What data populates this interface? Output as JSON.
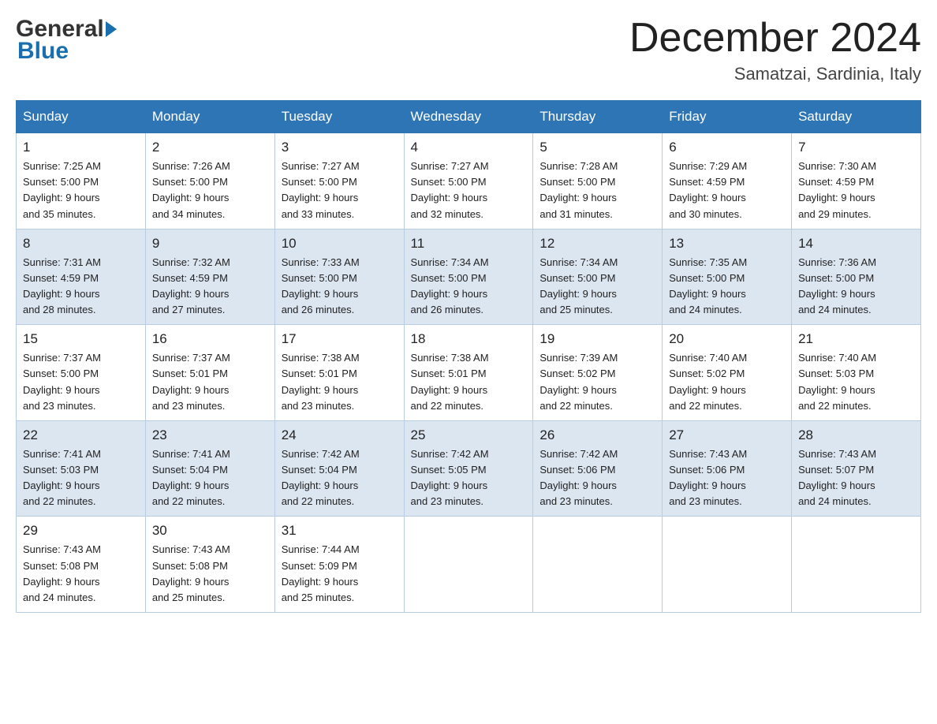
{
  "header": {
    "logo_general": "General",
    "logo_blue": "Blue",
    "month_title": "December 2024",
    "location": "Samatzai, Sardinia, Italy"
  },
  "days_of_week": [
    "Sunday",
    "Monday",
    "Tuesday",
    "Wednesday",
    "Thursday",
    "Friday",
    "Saturday"
  ],
  "weeks": [
    {
      "days": [
        {
          "num": "1",
          "sunrise": "7:25 AM",
          "sunset": "5:00 PM",
          "daylight": "9 hours and 35 minutes."
        },
        {
          "num": "2",
          "sunrise": "7:26 AM",
          "sunset": "5:00 PM",
          "daylight": "9 hours and 34 minutes."
        },
        {
          "num": "3",
          "sunrise": "7:27 AM",
          "sunset": "5:00 PM",
          "daylight": "9 hours and 33 minutes."
        },
        {
          "num": "4",
          "sunrise": "7:27 AM",
          "sunset": "5:00 PM",
          "daylight": "9 hours and 32 minutes."
        },
        {
          "num": "5",
          "sunrise": "7:28 AM",
          "sunset": "5:00 PM",
          "daylight": "9 hours and 31 minutes."
        },
        {
          "num": "6",
          "sunrise": "7:29 AM",
          "sunset": "4:59 PM",
          "daylight": "9 hours and 30 minutes."
        },
        {
          "num": "7",
          "sunrise": "7:30 AM",
          "sunset": "4:59 PM",
          "daylight": "9 hours and 29 minutes."
        }
      ]
    },
    {
      "days": [
        {
          "num": "8",
          "sunrise": "7:31 AM",
          "sunset": "4:59 PM",
          "daylight": "9 hours and 28 minutes."
        },
        {
          "num": "9",
          "sunrise": "7:32 AM",
          "sunset": "4:59 PM",
          "daylight": "9 hours and 27 minutes."
        },
        {
          "num": "10",
          "sunrise": "7:33 AM",
          "sunset": "5:00 PM",
          "daylight": "9 hours and 26 minutes."
        },
        {
          "num": "11",
          "sunrise": "7:34 AM",
          "sunset": "5:00 PM",
          "daylight": "9 hours and 26 minutes."
        },
        {
          "num": "12",
          "sunrise": "7:34 AM",
          "sunset": "5:00 PM",
          "daylight": "9 hours and 25 minutes."
        },
        {
          "num": "13",
          "sunrise": "7:35 AM",
          "sunset": "5:00 PM",
          "daylight": "9 hours and 24 minutes."
        },
        {
          "num": "14",
          "sunrise": "7:36 AM",
          "sunset": "5:00 PM",
          "daylight": "9 hours and 24 minutes."
        }
      ]
    },
    {
      "days": [
        {
          "num": "15",
          "sunrise": "7:37 AM",
          "sunset": "5:00 PM",
          "daylight": "9 hours and 23 minutes."
        },
        {
          "num": "16",
          "sunrise": "7:37 AM",
          "sunset": "5:01 PM",
          "daylight": "9 hours and 23 minutes."
        },
        {
          "num": "17",
          "sunrise": "7:38 AM",
          "sunset": "5:01 PM",
          "daylight": "9 hours and 23 minutes."
        },
        {
          "num": "18",
          "sunrise": "7:38 AM",
          "sunset": "5:01 PM",
          "daylight": "9 hours and 22 minutes."
        },
        {
          "num": "19",
          "sunrise": "7:39 AM",
          "sunset": "5:02 PM",
          "daylight": "9 hours and 22 minutes."
        },
        {
          "num": "20",
          "sunrise": "7:40 AM",
          "sunset": "5:02 PM",
          "daylight": "9 hours and 22 minutes."
        },
        {
          "num": "21",
          "sunrise": "7:40 AM",
          "sunset": "5:03 PM",
          "daylight": "9 hours and 22 minutes."
        }
      ]
    },
    {
      "days": [
        {
          "num": "22",
          "sunrise": "7:41 AM",
          "sunset": "5:03 PM",
          "daylight": "9 hours and 22 minutes."
        },
        {
          "num": "23",
          "sunrise": "7:41 AM",
          "sunset": "5:04 PM",
          "daylight": "9 hours and 22 minutes."
        },
        {
          "num": "24",
          "sunrise": "7:42 AM",
          "sunset": "5:04 PM",
          "daylight": "9 hours and 22 minutes."
        },
        {
          "num": "25",
          "sunrise": "7:42 AM",
          "sunset": "5:05 PM",
          "daylight": "9 hours and 23 minutes."
        },
        {
          "num": "26",
          "sunrise": "7:42 AM",
          "sunset": "5:06 PM",
          "daylight": "9 hours and 23 minutes."
        },
        {
          "num": "27",
          "sunrise": "7:43 AM",
          "sunset": "5:06 PM",
          "daylight": "9 hours and 23 minutes."
        },
        {
          "num": "28",
          "sunrise": "7:43 AM",
          "sunset": "5:07 PM",
          "daylight": "9 hours and 24 minutes."
        }
      ]
    },
    {
      "days": [
        {
          "num": "29",
          "sunrise": "7:43 AM",
          "sunset": "5:08 PM",
          "daylight": "9 hours and 24 minutes."
        },
        {
          "num": "30",
          "sunrise": "7:43 AM",
          "sunset": "5:08 PM",
          "daylight": "9 hours and 25 minutes."
        },
        {
          "num": "31",
          "sunrise": "7:44 AM",
          "sunset": "5:09 PM",
          "daylight": "9 hours and 25 minutes."
        },
        null,
        null,
        null,
        null
      ]
    }
  ]
}
